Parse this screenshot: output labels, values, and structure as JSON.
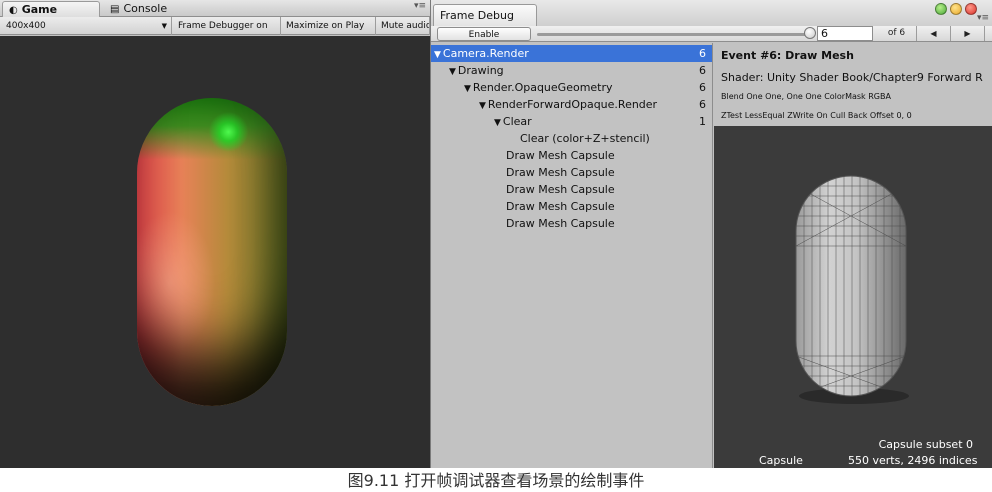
{
  "game_window": {
    "tabs": [
      {
        "label": "Game",
        "icon": "game-icon"
      },
      {
        "label": "Console",
        "icon": "console-icon"
      }
    ],
    "toolbar": {
      "resolution": "400x400",
      "frame_debugger_label": "Frame Debugger on",
      "maximize_label": "Maximize on Play",
      "mute_label": "Mute audio"
    },
    "colors": {
      "capsule_left": "#f04a4f",
      "capsule_right": "#5e6e22",
      "capsule_top": "#1e7f10",
      "specular": "#50ff50",
      "background": "#2e2e2e"
    }
  },
  "frame_debug": {
    "tab_title": "Frame Debug",
    "enable_label": "Enable",
    "event_value": "6",
    "of_text": "of 6",
    "prev_icon": "◀",
    "next_icon": "▶",
    "tree": [
      {
        "label": "Camera.Render",
        "count": "6",
        "expanded": true,
        "selected": true
      },
      {
        "label": "Drawing",
        "count": "6",
        "expanded": true
      },
      {
        "label": "Render.OpaqueGeometry",
        "count": "6",
        "expanded": true
      },
      {
        "label": "RenderForwardOpaque.Render",
        "count": "6",
        "expanded": true
      },
      {
        "label": "Clear",
        "count": "1",
        "expanded": true
      },
      {
        "label": "Clear (color+Z+stencil)",
        "count": ""
      },
      {
        "label": "Draw Mesh Capsule",
        "count": ""
      },
      {
        "label": "Draw Mesh Capsule",
        "count": ""
      },
      {
        "label": "Draw Mesh Capsule",
        "count": ""
      },
      {
        "label": "Draw Mesh Capsule",
        "count": ""
      },
      {
        "label": "Draw Mesh Capsule",
        "count": ""
      }
    ],
    "event": {
      "title": "Event #6: Draw Mesh",
      "shader": "Shader: Unity Shader Book/Chapter9 Forward R",
      "blend": "Blend One One, One One ColorMask RGBA",
      "ztest": "ZTest LessEqual ZWrite On Cull Back Offset 0, 0"
    },
    "preview": {
      "subset": "Capsule subset 0",
      "mesh_name": "Capsule",
      "stats": "550 verts, 2496 indices"
    }
  },
  "caption": "图9.11  打开帧调试器查看场景的绘制事件"
}
